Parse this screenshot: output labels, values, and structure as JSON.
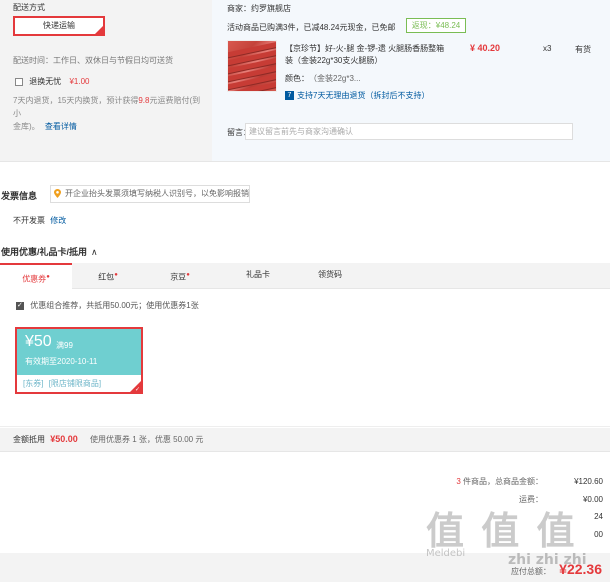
{
  "shipping": {
    "title": "配送方式",
    "option_label": "快递运输",
    "delivery_time": "配送时间：工作日、双休日与节假日均可送货",
    "return_label": "退换无忧",
    "return_price": "¥1.00",
    "return_desc_1": "7天内退货，15天内换货，预计获得",
    "return_desc_amount": "9.8",
    "return_desc_2": "元运费赔付(到小",
    "return_desc_3": "金库)。",
    "details_link": "查看详情"
  },
  "store": {
    "merchant_label": "商家：",
    "merchant_name": "约罗旗舰店",
    "promo_text": "活动商品已购满3件，已减48.24元现金，已免邮",
    "rebate_tag": "返现：¥48.24",
    "product_title": "【京珍节】好-火-腿 金-锣-遗 火腿肠香肠整箱装（金装22g*30支火腿肠）",
    "product_price": "¥ 40.20",
    "product_qty": "x3",
    "product_stock": "有货",
    "color_label": "颜色：",
    "color_value": "（金装22g*3...",
    "support_icon": "7",
    "support_text": "支持7天无理由退货（拆封后不支持）",
    "remark_label": "留言：",
    "remark_placeholder": "建议留言前先与商家沟通确认"
  },
  "invoice": {
    "title": "发票信息",
    "tip": "开企业抬头发票须填写纳税人识别号，以免影响报销",
    "type": "不开发票",
    "edit_link": "修改"
  },
  "discount": {
    "title": "使用优惠/礼品卡/抵用",
    "chevron": "∧",
    "tabs": [
      {
        "label": "优惠券",
        "dot": "●"
      },
      {
        "label": "红包",
        "dot": "●"
      },
      {
        "label": "京豆",
        "dot": "●"
      },
      {
        "label": "礼品卡",
        "dot": ""
      },
      {
        "label": "领货码",
        "dot": ""
      }
    ],
    "combo_text": "优惠组合推荐，共抵用50.00元；使用优惠券1张",
    "coupon": {
      "amount": "¥50",
      "condition": "满99",
      "validity": "有效期至2020-10-11",
      "tag1": "[东券]",
      "tag2": "[限店铺限商品]"
    },
    "amount_label": "金额抵用",
    "amount_value": "¥50.00",
    "amount_desc": "使用优惠券 1 张，优惠 50.00 元"
  },
  "summary": {
    "goods_count": "3",
    "goods_label": " 件商品，总商品金额：",
    "goods_total": "¥120.60",
    "shipping_label": "运费：",
    "shipping_value": "¥0.00",
    "row3_value": "24",
    "row4_value": "00",
    "total_label": "应付总额：",
    "total_value": "¥22.36"
  },
  "watermark": {
    "text": "值 值 值",
    "sub": "Meldebi",
    "brand": "zhi zhi zhi"
  }
}
